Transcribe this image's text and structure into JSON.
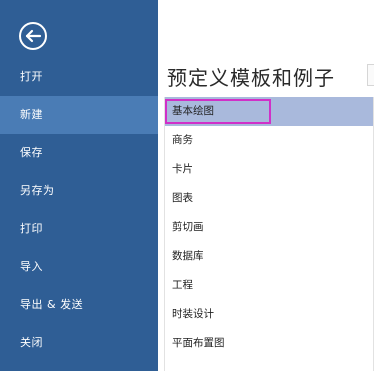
{
  "sidebar": {
    "back_icon": "back-arrow-circle-icon",
    "items": [
      {
        "label": "打开"
      },
      {
        "label": "新建",
        "active": true
      },
      {
        "label": "保存"
      },
      {
        "label": "另存为"
      },
      {
        "label": "打印"
      },
      {
        "label": "导入"
      },
      {
        "label": "导出 & 发送"
      },
      {
        "label": "关闭"
      }
    ]
  },
  "main": {
    "title": "预定义模板和例子",
    "templates": [
      "基本绘图",
      "商务",
      "卡片",
      "图表",
      "剪切画",
      "数据库",
      "工程",
      "时装设计",
      "平面布置图"
    ],
    "selected": "基本绘图"
  },
  "colors": {
    "sidebar_bg": "#2f5e95",
    "sidebar_active": "#4a7cb5",
    "selected_row": "#a9b9dc",
    "highlight_border": "#d030c8"
  }
}
